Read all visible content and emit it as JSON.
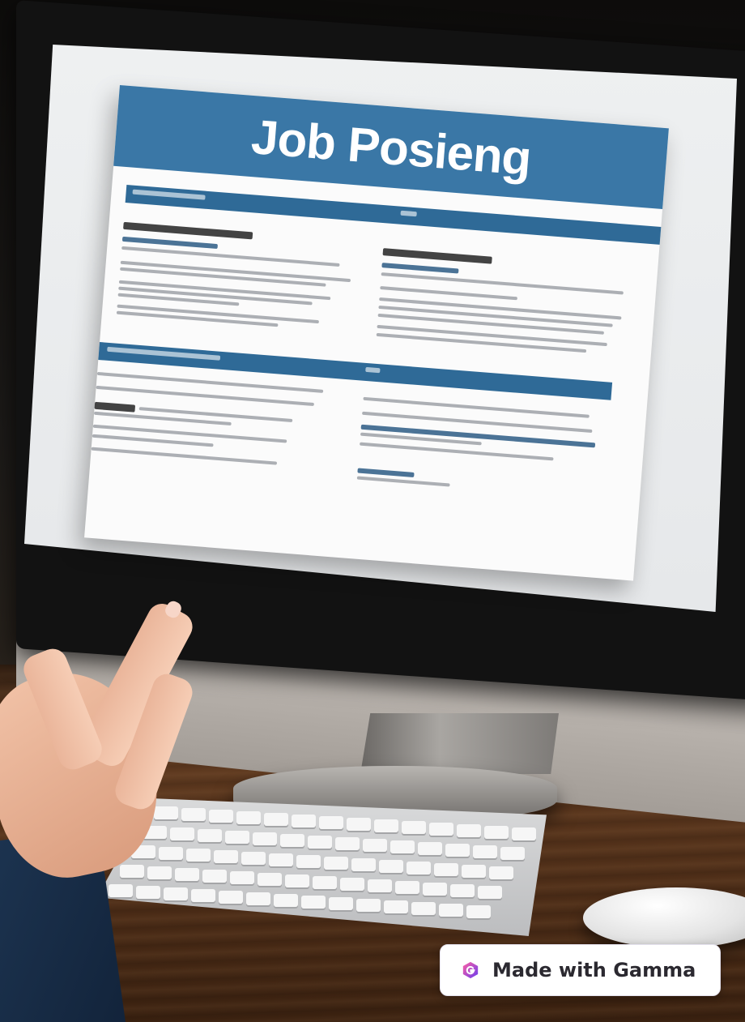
{
  "document": {
    "title": "Job Posieng"
  },
  "badge": {
    "label": "Made with Gamma",
    "icon": "gamma-logo-icon"
  },
  "colors": {
    "banner": "#3a77a6",
    "section_bar": "#2f6a97",
    "badge_bg": "#ffffff",
    "gamma_purple": "#7b3fe4"
  }
}
